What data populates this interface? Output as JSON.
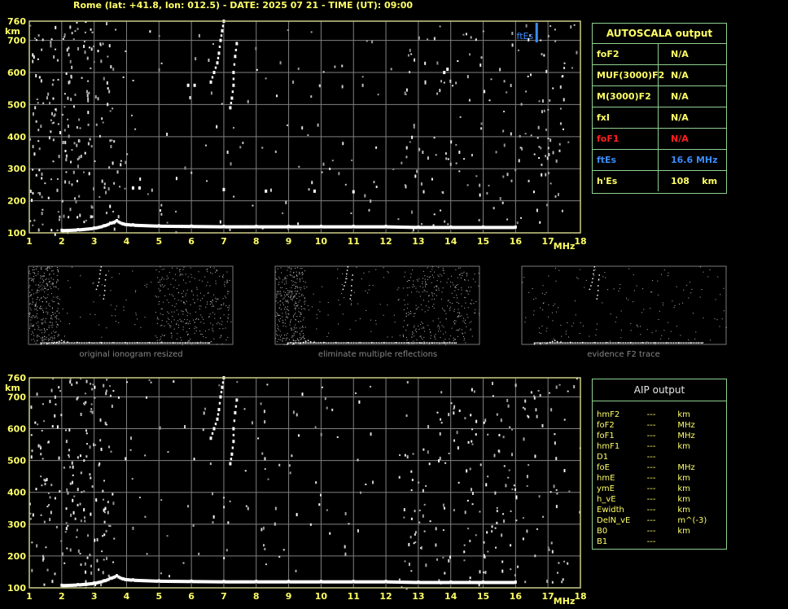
{
  "header": {
    "title": "Rome (lat: +41.8, lon: 012.5) - DATE: 2025 07 21 - TIME (UT): 09:00"
  },
  "colors": {
    "label_yellow": "#ffff66",
    "grid": "#808080",
    "border": "#cccc88",
    "panel_border": "#8fd08f",
    "fof1_red": "#ff2020",
    "ftes_blue": "#3a8cff",
    "trace_white": "#ffffff"
  },
  "autoscala": {
    "title": "AUTOSCALA output",
    "rows": [
      {
        "label": "foF2",
        "value": "N/A",
        "color": "#ffff66"
      },
      {
        "label": "MUF(3000)F2",
        "value": "N/A",
        "color": "#ffff66"
      },
      {
        "label": "M(3000)F2",
        "value": "N/A",
        "color": "#ffff66"
      },
      {
        "label": "fxI",
        "value": "N/A",
        "color": "#ffff66"
      },
      {
        "label": "foF1",
        "value": "N/A",
        "color": "#ff2020"
      },
      {
        "label": "ftEs",
        "value": "16.6 MHz",
        "color": "#3a8cff"
      },
      {
        "label": "h'Es",
        "value": "108    km",
        "color": "#ffff66"
      }
    ]
  },
  "aip": {
    "title": "AIP output",
    "rows": [
      {
        "label": "hmF2",
        "value": "---",
        "unit": "km"
      },
      {
        "label": "foF2",
        "value": "---",
        "unit": "MHz"
      },
      {
        "label": "foF1",
        "value": "---",
        "unit": "MHz"
      },
      {
        "label": "hmF1",
        "value": "---",
        "unit": "km"
      },
      {
        "label": "D1",
        "value": "---",
        "unit": ""
      },
      {
        "label": "foE",
        "value": "---",
        "unit": "MHz"
      },
      {
        "label": "hmE",
        "value": "---",
        "unit": "km"
      },
      {
        "label": "ymE",
        "value": "---",
        "unit": "km"
      },
      {
        "label": "h_vE",
        "value": "---",
        "unit": "km"
      },
      {
        "label": "Ewidth",
        "value": "---",
        "unit": "km"
      },
      {
        "label": "DelN_vE",
        "value": "---",
        "unit": "m^(-3)"
      },
      {
        "label": "B0",
        "value": "---",
        "unit": "km"
      },
      {
        "label": "B1",
        "value": "---",
        "unit": ""
      }
    ]
  },
  "thumbnails": [
    {
      "caption": "original ionogram resized"
    },
    {
      "caption": "eliminate multiple reflections"
    },
    {
      "caption": "evidence F2 trace"
    }
  ],
  "chart_data": [
    {
      "type": "scatter",
      "ylabel": "km",
      "xlabel": "MHz",
      "xlim": [
        1,
        18
      ],
      "ylim": [
        100,
        760
      ],
      "x_ticks": [
        1,
        2,
        3,
        4,
        5,
        6,
        7,
        8,
        9,
        10,
        11,
        12,
        13,
        14,
        15,
        16,
        17,
        18
      ],
      "y_ticks": [
        100,
        200,
        300,
        400,
        500,
        600,
        700,
        760
      ],
      "grid": true,
      "annotation": {
        "text": "ftEs",
        "x": 16.6
      },
      "series": [
        {
          "points": [
            [
              2,
              108
            ],
            [
              2.5,
              110
            ],
            [
              3,
              115
            ],
            [
              3.3,
              122
            ],
            [
              3.5,
              130
            ],
            [
              3.7,
              138
            ],
            [
              3.9,
              128
            ],
            [
              4.2,
              125
            ],
            [
              5,
              122
            ],
            [
              6,
              121
            ],
            [
              7,
              120
            ],
            [
              8,
              120
            ],
            [
              9,
              120
            ],
            [
              10,
              120
            ],
            [
              11,
              120
            ],
            [
              12,
              120
            ],
            [
              13,
              118
            ],
            [
              14,
              118
            ],
            [
              15,
              118
            ],
            [
              16,
              118
            ]
          ]
        },
        {
          "points": [
            [
              6.6,
              570
            ],
            [
              6.7,
              600
            ],
            [
              6.8,
              630
            ],
            [
              6.85,
              660
            ],
            [
              6.9,
              700
            ],
            [
              6.95,
              730
            ],
            [
              7.0,
              760
            ]
          ]
        },
        {
          "points": [
            [
              7.2,
              490
            ],
            [
              7.25,
              520
            ],
            [
              7.3,
              560
            ],
            [
              7.3,
              600
            ],
            [
              7.35,
              650
            ],
            [
              7.4,
              690
            ]
          ]
        },
        {
          "points": [
            [
              5.9,
              560
            ],
            [
              6.1,
              560
            ],
            [
              4.2,
              240
            ],
            [
              4.4,
              240
            ],
            [
              7,
              235
            ],
            [
              8.3,
              230
            ],
            [
              9.8,
              230
            ],
            [
              11,
              228
            ],
            [
              13.8,
              600
            ],
            [
              13.9,
              610
            ]
          ]
        }
      ]
    },
    {
      "type": "scatter",
      "ylabel": "km",
      "xlabel": "MHz",
      "xlim": [
        1,
        18
      ],
      "ylim": [
        100,
        760
      ],
      "x_ticks": [
        1,
        2,
        3,
        4,
        5,
        6,
        7,
        8,
        9,
        10,
        11,
        12,
        13,
        14,
        15,
        16,
        17,
        18
      ],
      "y_ticks": [
        100,
        200,
        300,
        400,
        500,
        600,
        700,
        760
      ],
      "grid": true,
      "series": [
        {
          "points": [
            [
              2,
              108
            ],
            [
              2.5,
              110
            ],
            [
              3,
              115
            ],
            [
              3.3,
              122
            ],
            [
              3.5,
              130
            ],
            [
              3.7,
              138
            ],
            [
              3.9,
              128
            ],
            [
              4.2,
              125
            ],
            [
              5,
              122
            ],
            [
              6,
              121
            ],
            [
              7,
              120
            ],
            [
              8,
              120
            ],
            [
              9,
              120
            ],
            [
              10,
              120
            ],
            [
              11,
              120
            ],
            [
              12,
              120
            ],
            [
              13,
              118
            ],
            [
              14,
              118
            ],
            [
              15,
              118
            ],
            [
              16,
              118
            ]
          ]
        },
        {
          "points": [
            [
              6.6,
              570
            ],
            [
              6.7,
              600
            ],
            [
              6.8,
              630
            ],
            [
              6.85,
              660
            ],
            [
              6.9,
              700
            ],
            [
              6.95,
              730
            ],
            [
              7.0,
              760
            ]
          ]
        },
        {
          "points": [
            [
              7.2,
              490
            ],
            [
              7.25,
              520
            ],
            [
              7.3,
              560
            ],
            [
              7.3,
              600
            ],
            [
              7.35,
              650
            ],
            [
              7.4,
              690
            ]
          ]
        }
      ]
    }
  ]
}
